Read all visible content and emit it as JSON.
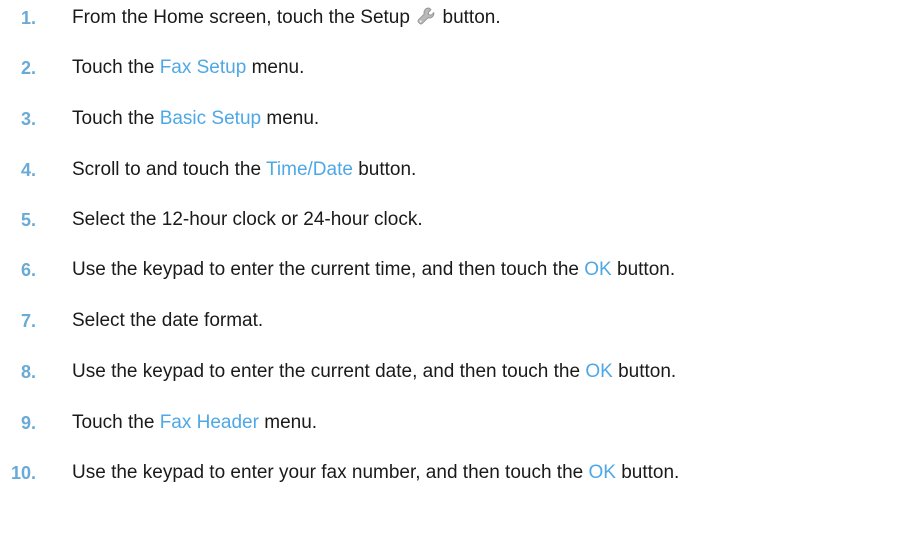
{
  "colors": {
    "step_number": "#6aaad6",
    "link": "#4fa8e6",
    "text": "#1a1a1a"
  },
  "steps": [
    {
      "number": "1.",
      "before": "From the Home screen, touch the Setup",
      "icon": "wrench-icon",
      "after": "button."
    },
    {
      "number": "2.",
      "before": "Touch the",
      "link": "Fax Setup",
      "after": "menu."
    },
    {
      "number": "3.",
      "before": "Touch the",
      "link": "Basic Setup",
      "after": "menu."
    },
    {
      "number": "4.",
      "before": "Scroll to and touch the",
      "link": "Time/Date",
      "after": "button."
    },
    {
      "number": "5.",
      "text": "Select the 12-hour clock or 24-hour clock."
    },
    {
      "number": "6.",
      "before": "Use the keypad to enter the current time, and then touch the",
      "link": "OK",
      "after": "button."
    },
    {
      "number": "7.",
      "text": "Select the date format."
    },
    {
      "number": "8.",
      "before": "Use the keypad to enter the current date, and then touch the",
      "link": "OK",
      "after": "button."
    },
    {
      "number": "9.",
      "before": "Touch the",
      "link": "Fax Header",
      "after": "menu."
    },
    {
      "number": "10.",
      "before": "Use the keypad to enter your fax number, and then touch the",
      "link": "OK",
      "after": "button."
    }
  ]
}
